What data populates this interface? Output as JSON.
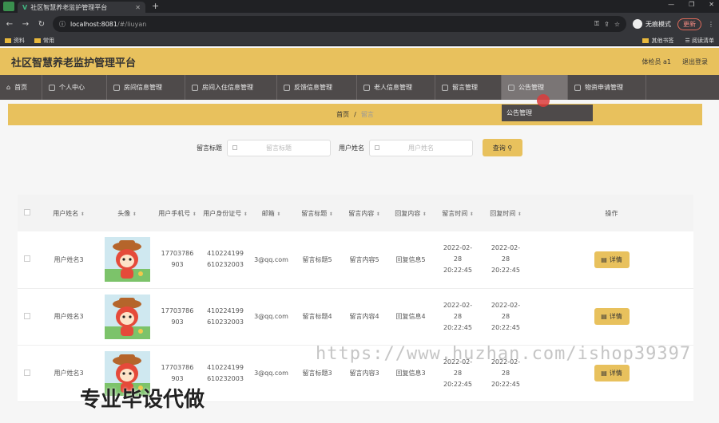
{
  "browser": {
    "tab_title": "社区智慧养老监护管理平台",
    "url_host": "localhost:8081",
    "url_path": "/#/liuyan",
    "incognito_label": "无痕模式",
    "update_label": "更新",
    "bookmarks": [
      "资料",
      "常用"
    ],
    "bookmarks_right": [
      "其他书签",
      "阅读清单"
    ]
  },
  "header": {
    "title": "社区智慧养老监护管理平台",
    "user": "体检员 a1",
    "logout": "退出登录"
  },
  "nav": [
    "首页",
    "个人中心",
    "房间信息管理",
    "房间入住信息管理",
    "反馈信息管理",
    "老人信息管理",
    "留言管理",
    "公告管理",
    "物资申请管理"
  ],
  "dropdown": {
    "item": "公告管理"
  },
  "breadcrumb": {
    "home": "首页",
    "sep": "/",
    "current": "留言"
  },
  "search": {
    "label1": "留言标题",
    "placeholder1": "留言标题",
    "label2": "用户姓名",
    "placeholder2": "用户姓名",
    "button": "查询"
  },
  "table": {
    "headers": [
      "用户姓名",
      "头像",
      "用户手机号",
      "用户身份证号",
      "邮箱",
      "留言标题",
      "留言内容",
      "回复内容",
      "留言时间",
      "回复时间",
      "操作"
    ],
    "rows": [
      {
        "name": "用户姓名3",
        "phone": "17703786903",
        "idcard": "410224199610232003",
        "email": "3@qq.com",
        "title": "留言标题5",
        "content": "留言内容5",
        "reply": "回复信息5",
        "time1": "2022-02-28 20:22:45",
        "time2": "2022-02-28 20:22:45",
        "action": "详情"
      },
      {
        "name": "用户姓名3",
        "phone": "17703786903",
        "idcard": "410224199610232003",
        "email": "3@qq.com",
        "title": "留言标题4",
        "content": "留言内容4",
        "reply": "回复信息4",
        "time1": "2022-02-28 20:22:45",
        "time2": "2022-02-28 20:22:45",
        "action": "详情"
      },
      {
        "name": "用户姓名3",
        "phone": "17703786903",
        "idcard": "410224199610232003",
        "email": "3@qq.com",
        "title": "留言标题3",
        "content": "留言内容3",
        "reply": "回复信息3",
        "time1": "2022-02-28 20:22:45",
        "time2": "2022-02-28 20:22:45",
        "action": "详情"
      }
    ]
  },
  "watermark": {
    "url": "https://www.huzhan.com/ishop39397",
    "text": "专业毕设代做"
  }
}
